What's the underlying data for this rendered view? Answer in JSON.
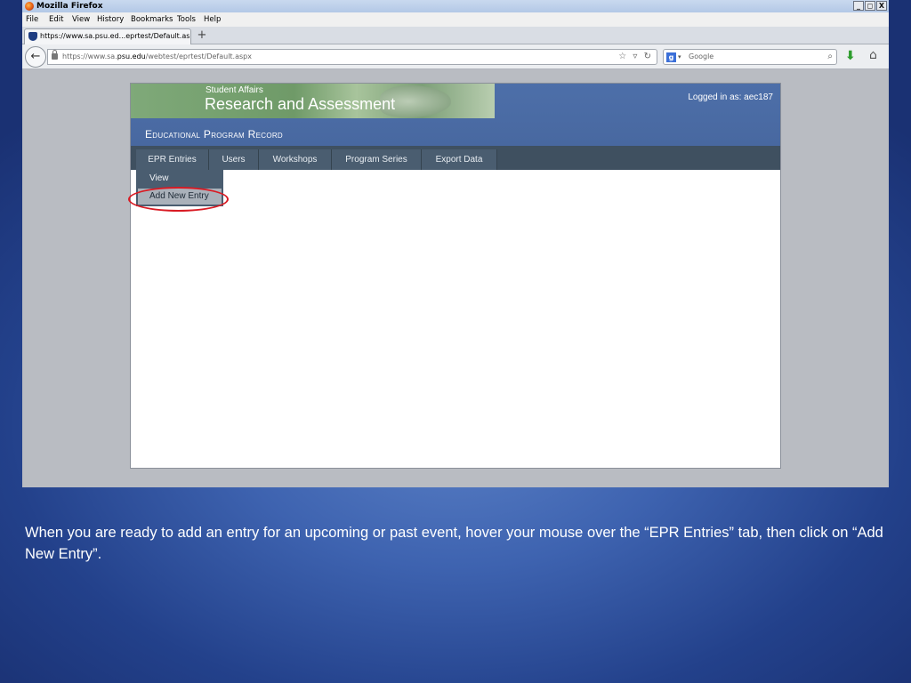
{
  "window": {
    "title": "Mozilla Firefox",
    "controls": [
      "_",
      "◻",
      "X"
    ]
  },
  "menubar": {
    "items": [
      "File",
      "Edit",
      "View",
      "History",
      "Bookmarks",
      "Tools",
      "Help"
    ]
  },
  "tabs": [
    {
      "label": "https://www.sa.psu.ed...eprtest/Default.aspx"
    }
  ],
  "new_tab_label": "+",
  "navbar": {
    "url_prefix": "https://www.sa.",
    "url_domain": "psu.edu",
    "url_path": "/webtest/eprtest/Default.aspx",
    "search_engine_label": "g",
    "search_placeholder": "Google"
  },
  "site": {
    "banner_subtitle": "Student Affairs",
    "banner_title": "Research and Assessment",
    "logged_in": "Logged in as: aec187",
    "program_title": "Educational Program Record",
    "nav_tabs": [
      "EPR Entries",
      "Users",
      "Workshops",
      "Program Series",
      "Export Data"
    ],
    "dropdown": [
      "View",
      "Add New Entry"
    ]
  },
  "caption": "When you are ready to add an entry for an upcoming or past event, hover your mouse over the “EPR Entries” tab, then click on “Add New Entry”.",
  "colors": {
    "highlight": "#d91b24",
    "site_header": "#4d6fa9",
    "nav_strip": "#3f5060"
  }
}
